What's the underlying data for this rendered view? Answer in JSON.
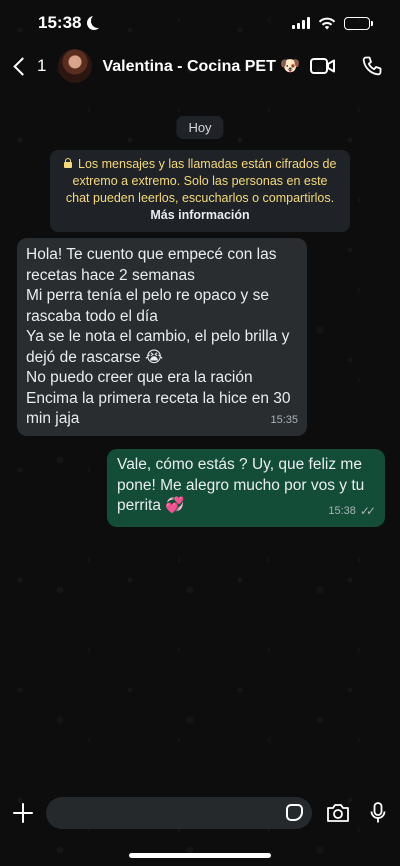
{
  "status_bar": {
    "time": "15:38"
  },
  "header": {
    "back_count": "1",
    "contact_name": "Valentina - Cocina PET 🐶"
  },
  "chat": {
    "date_label": "Hoy",
    "encryption_text": "Los mensajes y las llamadas están cifrados de extremo a extremo. Solo las personas en este chat pueden leerlos, escucharlos o compartirlos.",
    "encryption_link": "Más información",
    "messages": [
      {
        "direction": "incoming",
        "lines": [
          "Hola! Te cuento que empecé con las recetas hace 2 semanas",
          "Mi perra tenía el pelo re opaco y se rascaba todo el día",
          "Ya se le nota el cambio, el pelo brilla y dejó de rascarse 😭",
          "No puedo creer que era la ración",
          "Encima la primera receta la hice en 30 min jaja"
        ],
        "time": "15:35"
      },
      {
        "direction": "outgoing",
        "lines": [
          "Vale, cómo estás ? Uy, que feliz me pone! Me alegro mucho por vos y tu perrita 💞"
        ],
        "time": "15:38",
        "status": "read"
      }
    ]
  },
  "composer": {
    "placeholder": ""
  },
  "colors": {
    "background": "#0d0d0d",
    "incoming_bubble": "#2a2d30",
    "outgoing_bubble": "#134d37",
    "encryption_text": "#f5d97a"
  },
  "icons": [
    "moon-icon",
    "signal-icon",
    "wifi-icon",
    "battery-icon",
    "back-chevron-icon",
    "video-call-icon",
    "phone-icon",
    "lock-icon",
    "read-ticks-icon",
    "plus-icon",
    "sticker-icon",
    "camera-icon",
    "microphone-icon"
  ]
}
